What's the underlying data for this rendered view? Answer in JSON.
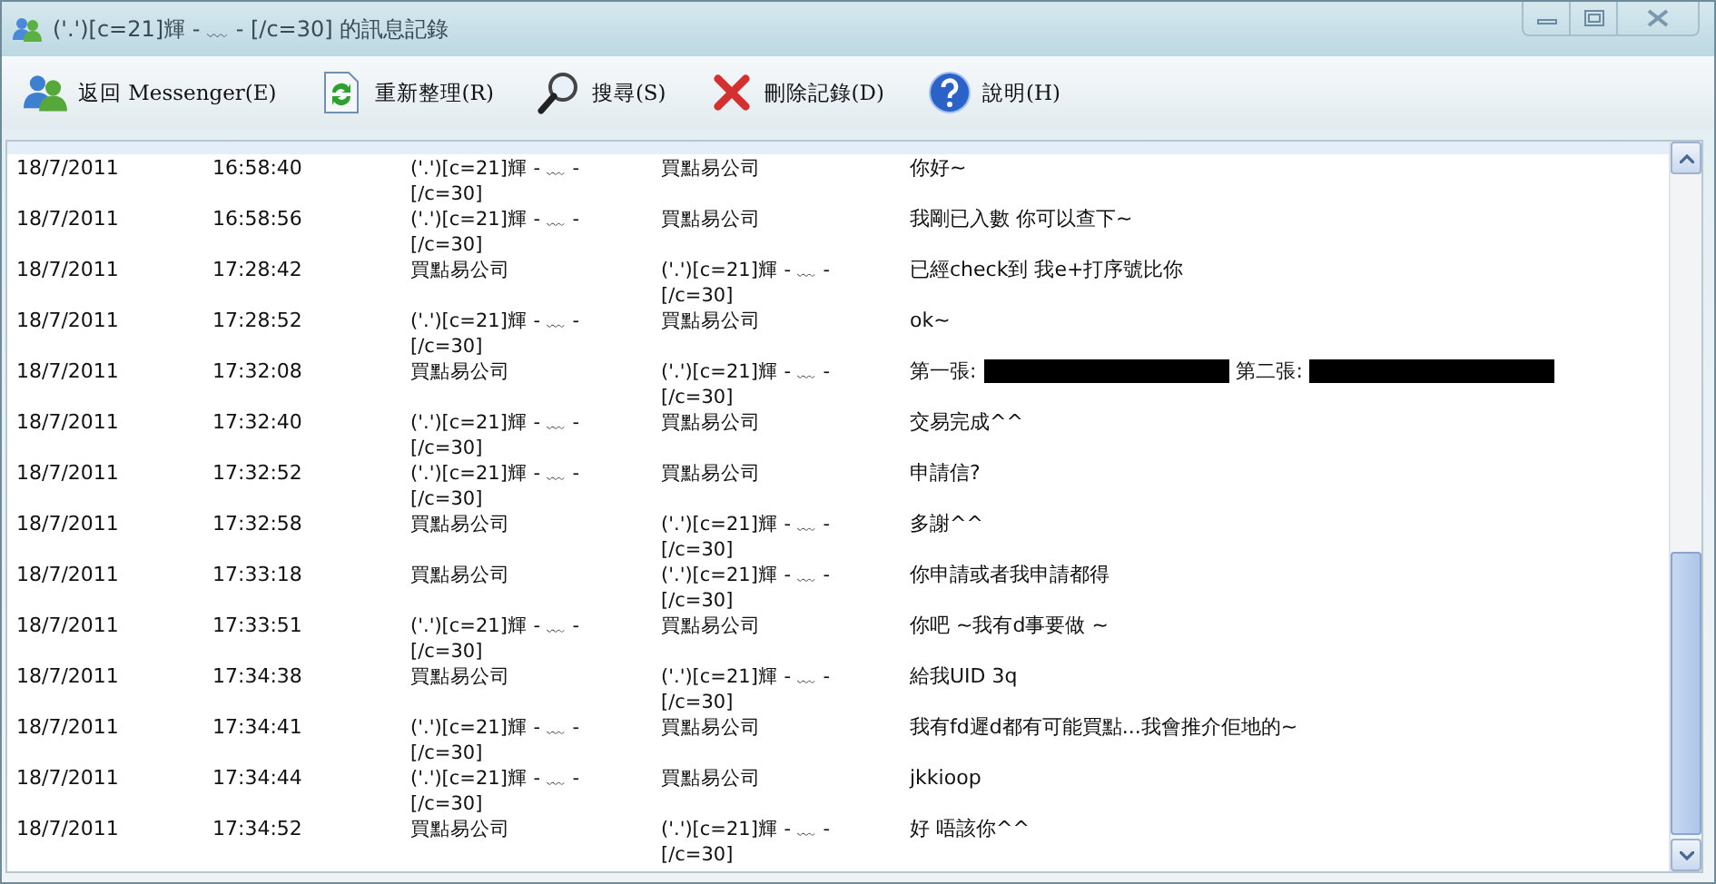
{
  "window": {
    "title": "('.')[c=21]輝 - ﹏ - [/c=30] 的訊息記錄"
  },
  "toolbar": [
    {
      "kind": "back",
      "label": "返回 Messenger(E)"
    },
    {
      "kind": "refresh",
      "label": "重新整理(R)"
    },
    {
      "kind": "search",
      "label": "搜尋(S)"
    },
    {
      "kind": "delete",
      "label": "刪除記錄(D)"
    },
    {
      "kind": "help",
      "label": "說明(H)"
    }
  ],
  "rows": [
    {
      "date": "18/7/2011",
      "time": "16:58:40",
      "from": "('.')[c=21]輝 - ﹏ - [/c=30]",
      "to": "買點易公司",
      "message": [
        {
          "kind": "text",
          "text": "你好~"
        }
      ]
    },
    {
      "date": "18/7/2011",
      "time": "16:58:56",
      "from": "('.')[c=21]輝 - ﹏ - [/c=30]",
      "to": "買點易公司",
      "message": [
        {
          "kind": "text",
          "text": "我剛已入數 你可以查下~"
        }
      ]
    },
    {
      "date": "18/7/2011",
      "time": "17:28:42",
      "from": "買點易公司",
      "to": "('.')[c=21]輝 - ﹏ - [/c=30]",
      "message": [
        {
          "kind": "text",
          "text": "已經check到 我e+打序號比你"
        }
      ]
    },
    {
      "date": "18/7/2011",
      "time": "17:28:52",
      "from": "('.')[c=21]輝 - ﹏ - [/c=30]",
      "to": "買點易公司",
      "message": [
        {
          "kind": "text",
          "text": "ok~"
        }
      ]
    },
    {
      "date": "18/7/2011",
      "time": "17:32:08",
      "from": "買點易公司",
      "to": "('.')[c=21]輝 - ﹏ - [/c=30]",
      "message": [
        {
          "kind": "text",
          "text": "第一張:"
        },
        {
          "kind": "redacted"
        },
        {
          "kind": "text",
          "text": "第二張:"
        },
        {
          "kind": "redacted"
        }
      ]
    },
    {
      "date": "18/7/2011",
      "time": "17:32:40",
      "from": "('.')[c=21]輝 - ﹏ - [/c=30]",
      "to": "買點易公司",
      "message": [
        {
          "kind": "text",
          "text": "交易完成^^"
        }
      ]
    },
    {
      "date": "18/7/2011",
      "time": "17:32:52",
      "from": "('.')[c=21]輝 - ﹏ - [/c=30]",
      "to": "買點易公司",
      "message": [
        {
          "kind": "text",
          "text": "申請信?"
        }
      ]
    },
    {
      "date": "18/7/2011",
      "time": "17:32:58",
      "from": "買點易公司",
      "to": "('.')[c=21]輝 - ﹏ - [/c=30]",
      "message": [
        {
          "kind": "text",
          "text": "多謝^^"
        }
      ]
    },
    {
      "date": "18/7/2011",
      "time": "17:33:18",
      "from": "買點易公司",
      "to": "('.')[c=21]輝 - ﹏ - [/c=30]",
      "message": [
        {
          "kind": "text",
          "text": "你申請或者我申請都得"
        }
      ]
    },
    {
      "date": "18/7/2011",
      "time": "17:33:51",
      "from": "('.')[c=21]輝 - ﹏ - [/c=30]",
      "to": "買點易公司",
      "message": [
        {
          "kind": "text",
          "text": "你吧 ~我有d事要做 ~"
        }
      ]
    },
    {
      "date": "18/7/2011",
      "time": "17:34:38",
      "from": "買點易公司",
      "to": "('.')[c=21]輝 - ﹏ - [/c=30]",
      "message": [
        {
          "kind": "text",
          "text": "給我UID 3q"
        }
      ]
    },
    {
      "date": "18/7/2011",
      "time": "17:34:41",
      "from": "('.')[c=21]輝 - ﹏ - [/c=30]",
      "to": "買點易公司",
      "message": [
        {
          "kind": "text",
          "text": "我有fd遲d都有可能買點...我會推介佢地的~"
        }
      ]
    },
    {
      "date": "18/7/2011",
      "time": "17:34:44",
      "from": "('.')[c=21]輝 - ﹏ - [/c=30]",
      "to": "買點易公司",
      "message": [
        {
          "kind": "text",
          "text": "jkkioop"
        }
      ]
    },
    {
      "date": "18/7/2011",
      "time": "17:34:52",
      "from": "買點易公司",
      "to": "('.')[c=21]輝 - ﹏ - [/c=30]",
      "message": [
        {
          "kind": "text",
          "text": "好 唔該你^^"
        }
      ]
    }
  ]
}
